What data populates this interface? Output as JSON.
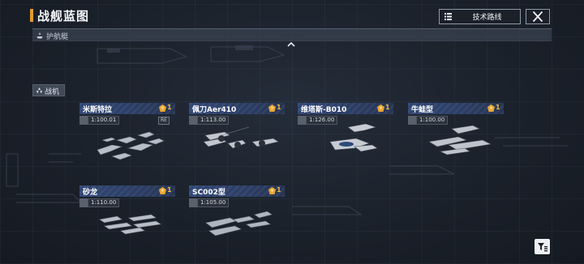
{
  "header": {
    "title": "战舰蓝图",
    "tech_button_label": "技术路线"
  },
  "escort_section": {
    "label": "护航艇"
  },
  "fighter_section": {
    "label": "战机"
  },
  "cards": [
    {
      "name": "米斯特拉",
      "cost": "1",
      "level": "1:100.01",
      "tag": "RE"
    },
    {
      "name": "佩刀Aer410",
      "cost": "1",
      "level": "1:113.00",
      "tag": ""
    },
    {
      "name": "维塔斯-B010",
      "cost": "1",
      "level": "1:126.00",
      "tag": ""
    },
    {
      "name": "牛蛙型",
      "cost": "1",
      "level": "1:100.00",
      "tag": ""
    },
    {
      "name": "砂龙",
      "cost": "1",
      "level": "1:110.00",
      "tag": ""
    },
    {
      "name": "SC002型",
      "cost": "1",
      "level": "1:105.00",
      "tag": ""
    }
  ],
  "colors": {
    "accent": "#e39a2c",
    "card_header": "#2f4675",
    "cost": "#e8b64a",
    "background": "#1a2029"
  },
  "icons": [
    "list-icon",
    "close-icon",
    "escort-icon",
    "chevron-up-icon",
    "fighter-icon",
    "cost-gem-icon",
    "level-icon",
    "filter-icon"
  ]
}
